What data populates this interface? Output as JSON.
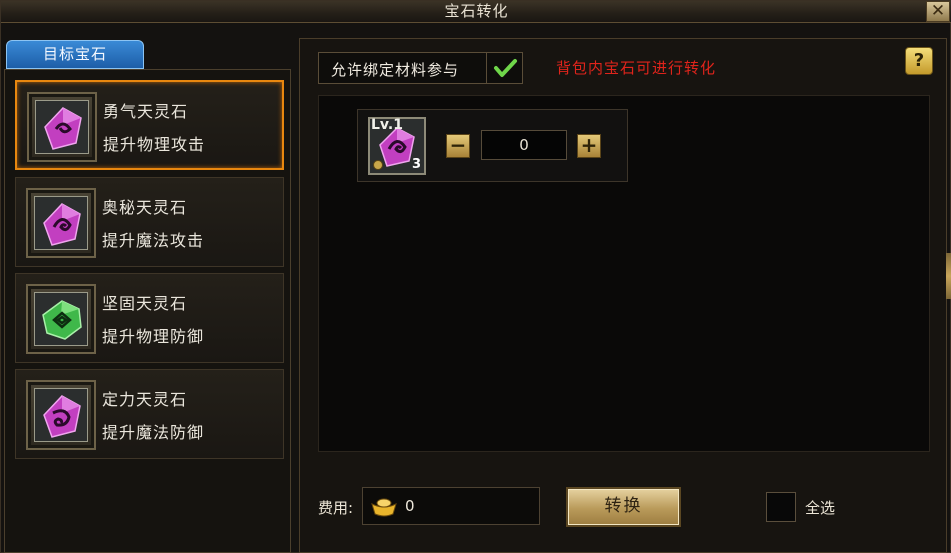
{
  "window": {
    "title": "宝石转化",
    "close_label": "✕"
  },
  "left": {
    "tab_label": "目标宝石",
    "gems": [
      {
        "name": "勇气天灵石",
        "desc": "提升物理攻击",
        "icon": "purple-gem-icon",
        "selected": true
      },
      {
        "name": "奥秘天灵石",
        "desc": "提升魔法攻击",
        "icon": "purple-gem-icon",
        "selected": false
      },
      {
        "name": "坚固天灵石",
        "desc": "提升物理防御",
        "icon": "green-gem-icon",
        "selected": false
      },
      {
        "name": "定力天灵石",
        "desc": "提升魔法防御",
        "icon": "purple-gem-icon",
        "selected": false
      }
    ]
  },
  "right": {
    "bind_label": "允许绑定材料参与",
    "bind_checked": true,
    "notice": "背包内宝石可进行转化",
    "help_label": "?",
    "source_gem": {
      "level": "Lv.1",
      "count": "3",
      "quantity": "0",
      "minus_label": "−",
      "plus_label": "+"
    },
    "fee_label": "费用:",
    "fee_value": "0",
    "convert_label": "转换",
    "select_all_label": "全选"
  },
  "colors": {
    "selected_border": "#e8870f",
    "notice": "#e0241b",
    "tab": "#2a74c0",
    "gem_purple": "#c23fc0",
    "gem_green": "#3fb84a"
  }
}
